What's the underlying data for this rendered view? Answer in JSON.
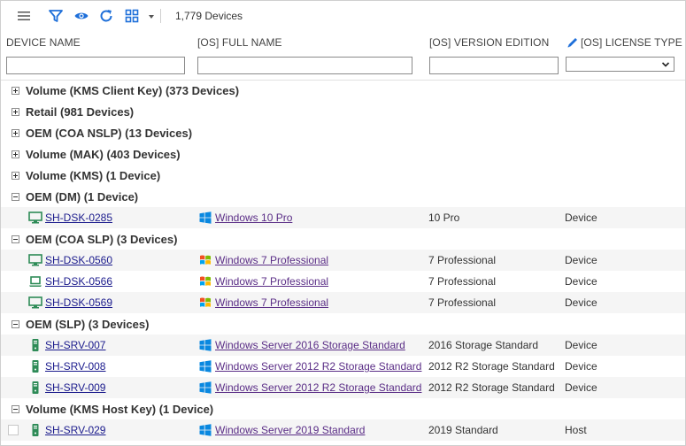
{
  "toolbar": {
    "device_count": "1,779 Devices",
    "icons": [
      "menu-icon",
      "filter-icon",
      "eye-icon",
      "refresh-icon",
      "grid-icon",
      "caret-down-icon"
    ],
    "accent_color": "#1e6fd9"
  },
  "columns": {
    "device_name": "DEVICE NAME",
    "os_full_name": "[OS] FULL NAME",
    "os_version_edition": "[OS] VERSION EDITION",
    "os_license_type": "[OS] LICENSE TYPE"
  },
  "groups": [
    {
      "label": "Volume (KMS Client Key) (373 Devices)",
      "expanded": false,
      "rows": []
    },
    {
      "label": "Retail (981 Devices)",
      "expanded": false,
      "rows": []
    },
    {
      "label": "OEM (COA NSLP) (13 Devices)",
      "expanded": false,
      "rows": []
    },
    {
      "label": "Volume (MAK) (403 Devices)",
      "expanded": false,
      "rows": []
    },
    {
      "label": "Volume (KMS) (1 Device)",
      "expanded": false,
      "rows": []
    },
    {
      "label": "OEM (DM) (1 Device)",
      "expanded": true,
      "rows": [
        {
          "device": "SH-DSK-0285",
          "device_icon": "desktop-icon",
          "os": "Windows 10 Pro",
          "os_icon": "windows10-icon",
          "edition": "10 Pro",
          "license": "Device"
        }
      ]
    },
    {
      "label": "OEM (COA SLP) (3 Devices)",
      "expanded": true,
      "rows": [
        {
          "device": "SH-DSK-0560",
          "device_icon": "desktop-icon",
          "os": "Windows 7 Professional",
          "os_icon": "windows7-icon",
          "edition": "7 Professional",
          "license": "Device"
        },
        {
          "device": "SH-DSK-0566",
          "device_icon": "laptop-icon",
          "os": "Windows 7 Professional",
          "os_icon": "windows7-icon",
          "edition": "7 Professional",
          "license": "Device"
        },
        {
          "device": "SH-DSK-0569",
          "device_icon": "desktop-icon",
          "os": "Windows 7 Professional",
          "os_icon": "windows7-icon",
          "edition": "7 Professional",
          "license": "Device"
        }
      ]
    },
    {
      "label": "OEM (SLP) (3 Devices)",
      "expanded": true,
      "rows": [
        {
          "device": "SH-SRV-007",
          "device_icon": "server-icon",
          "os": "Windows Server 2016 Storage Standard",
          "os_icon": "windows10-icon",
          "edition": "2016 Storage Standard",
          "license": "Device"
        },
        {
          "device": "SH-SRV-008",
          "device_icon": "server-icon",
          "os": "Windows Server 2012 R2 Storage Standard",
          "os_icon": "windows10-icon",
          "edition": "2012 R2 Storage Standard",
          "license": "Device"
        },
        {
          "device": "SH-SRV-009",
          "device_icon": "server-icon",
          "os": "Windows Server 2012 R2 Storage Standard",
          "os_icon": "windows10-icon",
          "edition": "2012 R2 Storage Standard",
          "license": "Device"
        }
      ]
    },
    {
      "label": "Volume (KMS Host Key) (1 Device)",
      "expanded": true,
      "rows": [
        {
          "device": "SH-SRV-029",
          "device_icon": "server-icon",
          "os": "Windows Server 2019 Standard",
          "os_icon": "windows10-icon",
          "edition": "2019 Standard",
          "license": "Host"
        }
      ]
    }
  ]
}
